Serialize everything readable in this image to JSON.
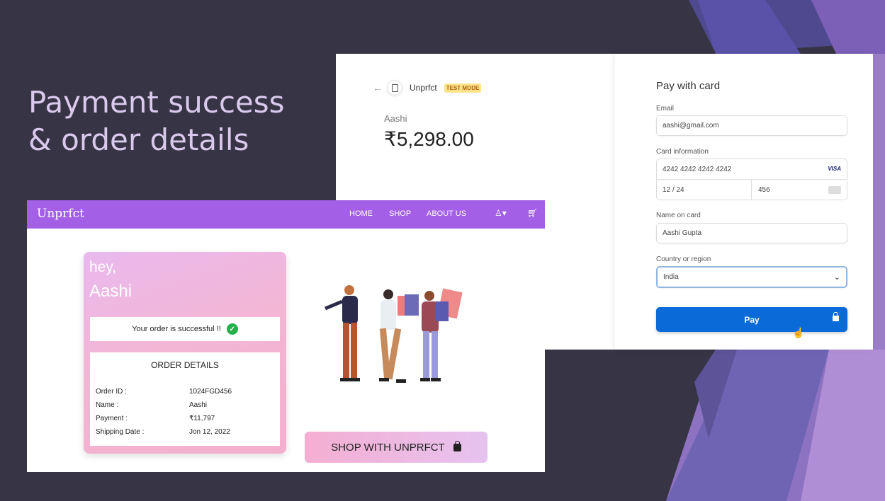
{
  "slide": {
    "title_line1": "Payment success",
    "title_line2": "& order details"
  },
  "checkout": {
    "back_icon": "arrow-left-icon",
    "merchant": "Unprfct",
    "mode_badge": "TEST MODE",
    "payer": "Aashi",
    "amount": "₹5,298.00",
    "pay_title": "Pay with card",
    "email_label": "Email",
    "email_value": "aashi@gmail.com",
    "card_label": "Card information",
    "card_number": "4242 4242 4242 4242",
    "card_brand": "VISA",
    "card_expiry": "12 / 24",
    "card_cvc": "456",
    "name_label": "Name on card",
    "name_value": "Aashi Gupta",
    "country_label": "Country or region",
    "country_value": "India",
    "pay_button": "Pay"
  },
  "site": {
    "brand": "Unprfct",
    "nav": [
      "HOME",
      "SHOP",
      "ABOUT US"
    ],
    "greeting": "hey,",
    "user_name": "Aashi",
    "success_message": "Your order is successful !!",
    "order_details_title": "ORDER DETAILS",
    "order_rows": [
      {
        "label": "Order ID :",
        "value": "1024FGD456"
      },
      {
        "label": "Name :",
        "value": "Aashi"
      },
      {
        "label": "Payment :",
        "value": "₹11,797"
      },
      {
        "label": "Shipping Date :",
        "value": "Jon 12, 2022"
      }
    ],
    "shop_button": "SHOP WITH UNPRFCT"
  },
  "colors": {
    "nav_purple": "#a35fe6",
    "pay_blue": "#0a6ad8",
    "background": "#373445",
    "success_green": "#22b04b"
  }
}
